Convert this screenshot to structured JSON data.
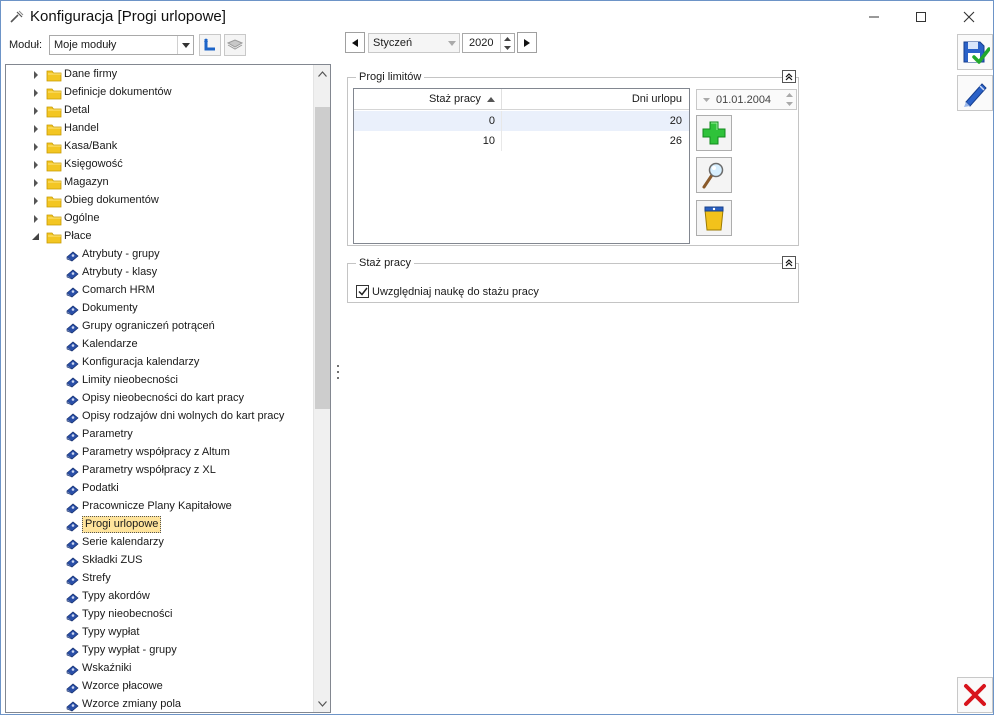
{
  "window": {
    "title": "Konfiguracja [Progi urlopowe]"
  },
  "module": {
    "label": "Moduł:",
    "selected": "Moje moduły"
  },
  "tree": {
    "items": [
      {
        "label": "Dane firmy",
        "level": 0,
        "expanded": false
      },
      {
        "label": "Definicje dokumentów",
        "level": 0,
        "expanded": false
      },
      {
        "label": "Detal",
        "level": 0,
        "expanded": false
      },
      {
        "label": "Handel",
        "level": 0,
        "expanded": false
      },
      {
        "label": "Kasa/Bank",
        "level": 0,
        "expanded": false
      },
      {
        "label": "Księgowość",
        "level": 0,
        "expanded": false
      },
      {
        "label": "Magazyn",
        "level": 0,
        "expanded": false
      },
      {
        "label": "Obieg dokumentów",
        "level": 0,
        "expanded": false
      },
      {
        "label": "Ogólne",
        "level": 0,
        "expanded": false
      },
      {
        "label": "Płace",
        "level": 0,
        "expanded": true
      },
      {
        "label": "Atrybuty - grupy",
        "level": 1
      },
      {
        "label": "Atrybuty - klasy",
        "level": 1
      },
      {
        "label": "Comarch HRM",
        "level": 1
      },
      {
        "label": "Dokumenty",
        "level": 1
      },
      {
        "label": "Grupy ograniczeń potrąceń",
        "level": 1
      },
      {
        "label": "Kalendarze",
        "level": 1
      },
      {
        "label": "Konfiguracja kalendarzy",
        "level": 1
      },
      {
        "label": "Limity nieobecności",
        "level": 1
      },
      {
        "label": "Opisy nieobecności do kart pracy",
        "level": 1
      },
      {
        "label": "Opisy rodzajów dni wolnych do kart pracy",
        "level": 1
      },
      {
        "label": "Parametry",
        "level": 1
      },
      {
        "label": "Parametry współpracy z Altum",
        "level": 1
      },
      {
        "label": "Parametry współpracy z XL",
        "level": 1
      },
      {
        "label": "Podatki",
        "level": 1
      },
      {
        "label": "Pracownicze Plany Kapitałowe",
        "level": 1
      },
      {
        "label": "Progi urlopowe",
        "level": 1,
        "selected": true
      },
      {
        "label": "Serie kalendarzy",
        "level": 1
      },
      {
        "label": "Składki ZUS",
        "level": 1
      },
      {
        "label": "Strefy",
        "level": 1
      },
      {
        "label": "Typy akordów",
        "level": 1
      },
      {
        "label": "Typy nieobecności",
        "level": 1
      },
      {
        "label": "Typy wypłat",
        "level": 1
      },
      {
        "label": "Typy wypłat - grupy",
        "level": 1
      },
      {
        "label": "Wskaźniki",
        "level": 1
      },
      {
        "label": "Wzorce płacowe",
        "level": 1
      },
      {
        "label": "Wzorce zmiany pola",
        "level": 1
      }
    ]
  },
  "period": {
    "month": "Styczeń",
    "year": "2020"
  },
  "limits_group": {
    "title": "Progi limitów",
    "columns": [
      "Staż pracy",
      "Dni urlopu"
    ],
    "rows": [
      {
        "staz": "0",
        "dni": "20"
      },
      {
        "staz": "10",
        "dni": "26"
      }
    ],
    "date": "01.01.2004"
  },
  "staz_group": {
    "title": "Staż pracy",
    "checkbox_label": "Uwzględniaj naukę do stażu pracy",
    "checked": true
  },
  "colors": {
    "selection": "#ffe49c",
    "accent": "#1c64c8",
    "folder": "#f3c623"
  }
}
